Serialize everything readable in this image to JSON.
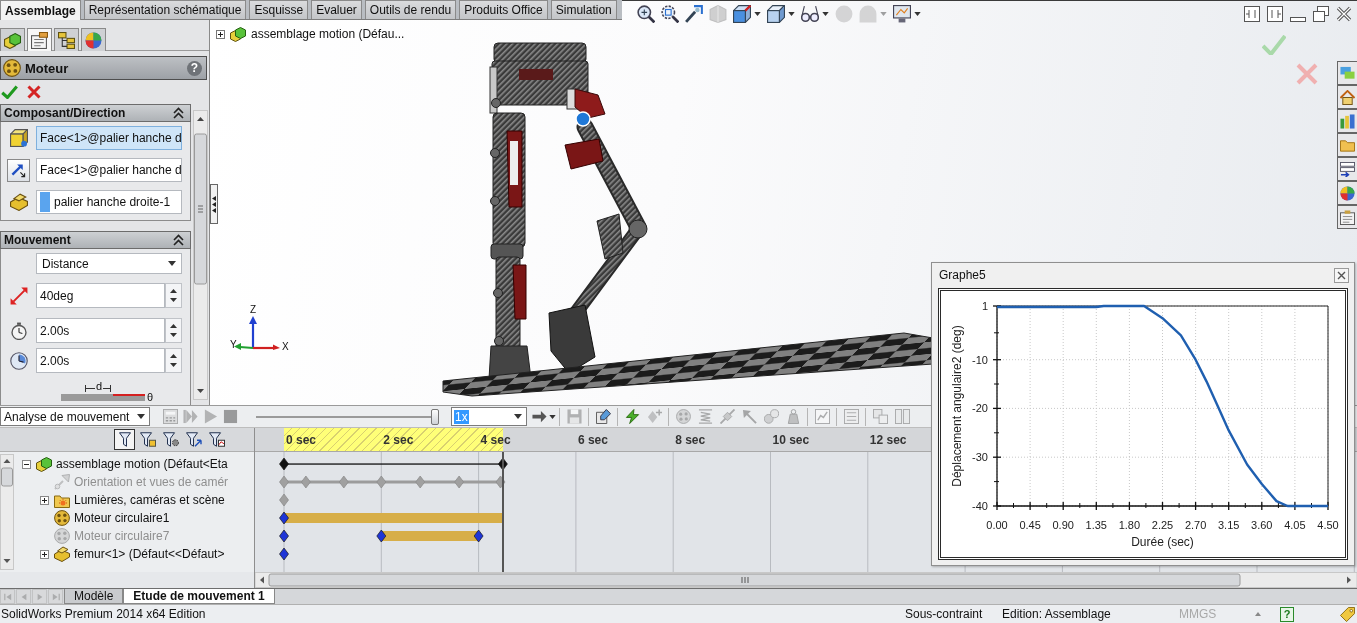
{
  "command_tabs": [
    {
      "label": "Assemblage",
      "selected": true
    },
    {
      "label": "Représentation schématique",
      "selected": false
    },
    {
      "label": "Esquisse",
      "selected": false
    },
    {
      "label": "Evaluer",
      "selected": false
    },
    {
      "label": "Outils de rendu",
      "selected": false
    },
    {
      "label": "Produits Office",
      "selected": false
    },
    {
      "label": "Simulation",
      "selected": false
    }
  ],
  "property_manager": {
    "tabs": [
      {
        "kind": "feature-tree",
        "selected": false
      },
      {
        "kind": "property",
        "selected": true
      },
      {
        "kind": "configuration",
        "selected": false
      },
      {
        "kind": "display",
        "selected": false
      }
    ],
    "title": "Moteur",
    "help": "?",
    "groups": [
      {
        "title": "Composant/Direction",
        "expanded": true,
        "fields": [
          {
            "kind": "face",
            "value": "Face<1>@palier hanche d",
            "active": true
          },
          {
            "kind": "direction",
            "value": "Face<1>@palier hanche d",
            "active": false
          },
          {
            "kind": "component",
            "value": "palier hanche droite-1",
            "active": false
          }
        ]
      },
      {
        "title": "Mouvement",
        "expanded": true,
        "function": "Distance",
        "fields": [
          {
            "kind": "distance",
            "value": "40deg",
            "active": false
          },
          {
            "kind": "start-time",
            "value": "2.00s",
            "active": false
          },
          {
            "kind": "duration",
            "value": "2.00s",
            "active": false
          }
        ],
        "profile_labels": [
          "d",
          "θ"
        ]
      }
    ]
  },
  "graphics": {
    "view_toolbar": [
      {
        "kind": "zoom-fit",
        "disabled": false,
        "menu": false
      },
      {
        "kind": "zoom-area",
        "disabled": false,
        "menu": false
      },
      {
        "kind": "previous-view",
        "disabled": false,
        "menu": false
      },
      {
        "kind": "section-view",
        "disabled": true,
        "menu": false
      },
      {
        "kind": "view-orientation",
        "disabled": false,
        "menu": true
      },
      {
        "kind": "display-style",
        "disabled": false,
        "menu": true
      },
      {
        "kind": "hide-show",
        "disabled": false,
        "menu": true
      },
      {
        "kind": "edit-appearance",
        "disabled": true,
        "menu": false
      },
      {
        "kind": "apply-scene",
        "disabled": true,
        "menu": true
      },
      {
        "kind": "view-settings",
        "disabled": false,
        "menu": true
      }
    ],
    "tree_flyout": {
      "label": "assemblage motion (Défau...",
      "expanded": false
    },
    "triad_labels": [
      "Z",
      "Y",
      "X"
    ]
  },
  "graph_window": {
    "title": "Graphe5",
    "chart_data": {
      "type": "line",
      "xlabel": "Durée (sec)",
      "ylabel": "Déplacement angulaire2 (deg)",
      "x": [
        0,
        0.45,
        0.9,
        1.35,
        1.45,
        1.8,
        2.0,
        2.25,
        2.5,
        2.7,
        2.85,
        3.0,
        3.15,
        3.4,
        3.6,
        3.8,
        3.95,
        4.05,
        4.5
      ],
      "series": [
        {
          "color": "#1f5fb0",
          "values": [
            0.8,
            0.8,
            0.8,
            0.8,
            1,
            1,
            1,
            -1.5,
            -5,
            -10,
            -14.5,
            -19.5,
            -24.5,
            -31.5,
            -35.5,
            -39,
            -40,
            -40,
            -40
          ]
        }
      ],
      "xlim": [
        0,
        4.5
      ],
      "ylim": [
        -40,
        1
      ],
      "xticks": [
        {
          "value": 0,
          "label": "0.00"
        },
        {
          "value": 0.45,
          "label": "0.45"
        },
        {
          "value": 0.9,
          "label": "0.90"
        },
        {
          "value": 1.35,
          "label": "1.35"
        },
        {
          "value": 1.8,
          "label": "1.80"
        },
        {
          "value": 2.25,
          "label": "2.25"
        },
        {
          "value": 2.7,
          "label": "2.70"
        },
        {
          "value": 3.15,
          "label": "3.15"
        },
        {
          "value": 3.6,
          "label": "3.60"
        },
        {
          "value": 4.05,
          "label": "4.05"
        },
        {
          "value": 4.5,
          "label": "4.50"
        }
      ],
      "yticks": [
        1,
        -10,
        -20,
        -30,
        -40
      ],
      "grid": true
    }
  },
  "motion_study": {
    "study_type": "Analyse de mouvement",
    "playback": [
      {
        "kind": "calculate",
        "disabled": true
      },
      {
        "kind": "play-from-start",
        "disabled": true
      },
      {
        "kind": "play",
        "disabled": true
      },
      {
        "kind": "stop",
        "disabled": true
      }
    ],
    "slider": {
      "level": 1
    },
    "speed": {
      "value": "1x",
      "highlighted": true
    },
    "tools": [
      {
        "kind": "playback-mode",
        "disabled": false,
        "menu": true
      },
      {
        "kind": "save-animation",
        "disabled": true,
        "menu": false
      },
      {
        "kind": "animation-wizard",
        "disabled": false,
        "menu": false
      },
      {
        "kind": "autokey",
        "disabled": false,
        "menu": false
      },
      {
        "kind": "add-key",
        "disabled": true,
        "menu": false
      },
      {
        "kind": "motor",
        "disabled": true,
        "menu": false
      },
      {
        "kind": "spring",
        "disabled": true,
        "menu": false
      },
      {
        "kind": "damper",
        "disabled": true,
        "menu": false
      },
      {
        "kind": "force",
        "disabled": true,
        "menu": false
      },
      {
        "kind": "contact",
        "disabled": true,
        "menu": false
      },
      {
        "kind": "gravity",
        "disabled": true,
        "menu": false
      },
      {
        "kind": "results",
        "disabled": true,
        "menu": false
      },
      {
        "kind": "study-properties",
        "disabled": true,
        "menu": false
      },
      {
        "kind": "collapse",
        "disabled": true,
        "menu": false
      },
      {
        "kind": "tile",
        "disabled": true,
        "menu": false
      }
    ],
    "filters": [
      {
        "kind": "filter-animated",
        "selected": true
      },
      {
        "kind": "filter-driving",
        "selected": false
      },
      {
        "kind": "filter-selected",
        "selected": false
      },
      {
        "kind": "filter-results",
        "selected": false
      },
      {
        "kind": "filter-plots",
        "selected": false
      }
    ],
    "time_labels": [
      "0 sec",
      "2 sec",
      "4 sec",
      "6 sec",
      "8 sec",
      "10 sec",
      "12 sec"
    ],
    "tree": [
      {
        "label": "assemblage motion (Défaut<Eta",
        "kind": "assembly",
        "track": {
          "kind": "span"
        },
        "expanded": true,
        "disabled": false,
        "children": [
          {
            "label": "Orientation et vues de camér",
            "kind": "camera",
            "track": {
              "kind": "camera-keys"
            },
            "disabled": true
          },
          {
            "label": "Lumières, caméras et scène",
            "kind": "lights",
            "track": {
              "kind": "key"
            },
            "expanded": false,
            "disabled": false
          },
          {
            "label": "Moteur circulaire1",
            "kind": "motor",
            "track": {
              "kind": "bar"
            },
            "disabled": false
          },
          {
            "label": "Moteur circulaire7",
            "kind": "motor",
            "track": {
              "kind": "late-bar"
            },
            "disabled": true
          },
          {
            "label": "femur<1> (Défaut<<Défaut>",
            "kind": "part",
            "track": {
              "kind": "blue-key"
            },
            "expanded": false,
            "disabled": false
          }
        ]
      }
    ],
    "tab_navigation": [
      {
        "kind": "first",
        "disabled": true
      },
      {
        "kind": "previous",
        "disabled": true
      },
      {
        "kind": "next",
        "disabled": true
      },
      {
        "kind": "last",
        "disabled": true
      }
    ],
    "tabs": [
      {
        "label": "Modèle",
        "selected": false
      },
      {
        "label": "Etude de mouvement 1",
        "selected": true
      }
    ]
  },
  "status_bar": {
    "product": "SolidWorks Premium 2014 x64 Edition",
    "state": "Sous-contraint",
    "mode": "Edition: Assemblage",
    "units": {
      "label": "MMGS",
      "disabled": true
    },
    "help": "?"
  }
}
